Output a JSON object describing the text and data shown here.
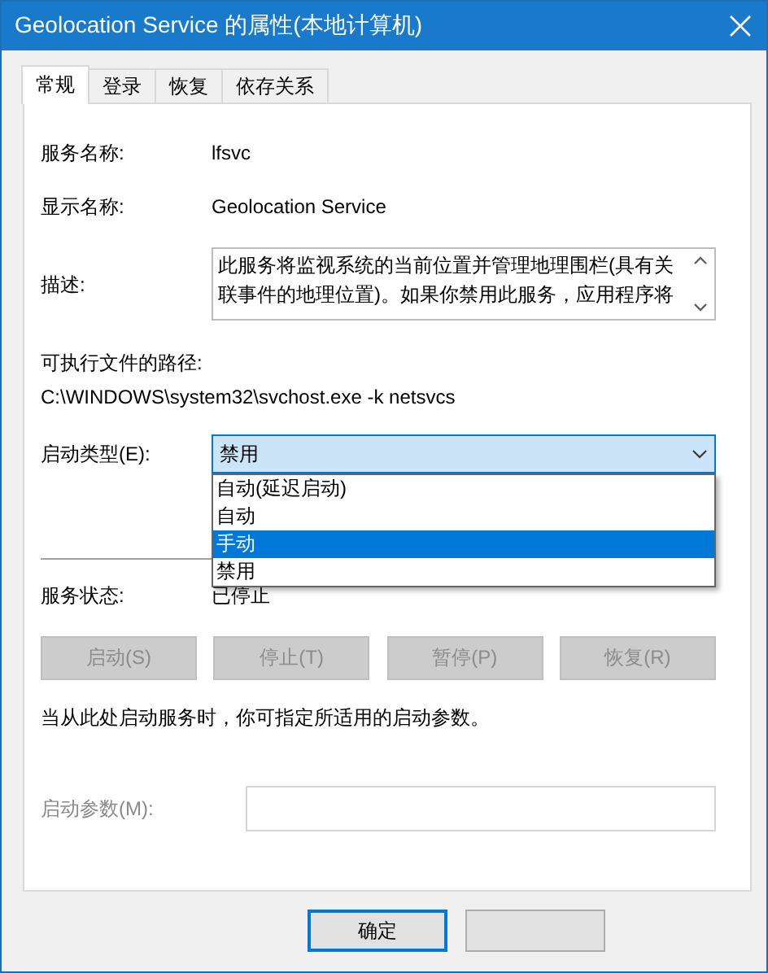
{
  "window": {
    "title": "Geolocation Service 的属性(本地计算机)"
  },
  "tabs": [
    {
      "label": "常规",
      "selected": true
    },
    {
      "label": "登录",
      "selected": false
    },
    {
      "label": "恢复",
      "selected": false
    },
    {
      "label": "依存关系",
      "selected": false
    }
  ],
  "fields": [
    {
      "label": "服务名称:",
      "value": "lfsvc"
    },
    {
      "label": "显示名称:",
      "value": "Geolocation Service"
    }
  ],
  "description": {
    "label": "描述:",
    "text": "此服务将监视系统的当前位置并管理地理围栏(具有关联事件的地理位置)。如果你禁用此服务，应用程序将"
  },
  "path": {
    "label": "可执行文件的路径:",
    "value": "C:\\WINDOWS\\system32\\svchost.exe -k netsvcs"
  },
  "startup_type": {
    "label": "启动类型(E):",
    "value": "禁用",
    "expanded": true,
    "options": [
      {
        "label": "自动(延迟启动)",
        "highlighted": false
      },
      {
        "label": "自动",
        "highlighted": false
      },
      {
        "label": "手动",
        "highlighted": true
      },
      {
        "label": "禁用",
        "highlighted": false
      }
    ]
  },
  "service_status": {
    "label": "服务状态:",
    "value": "已停止"
  },
  "service_buttons": [
    {
      "label": "启动(S)",
      "disabled": true
    },
    {
      "label": "停止(T)",
      "disabled": true
    },
    {
      "label": "暂停(P)",
      "disabled": true
    },
    {
      "label": "恢复(R)",
      "disabled": true
    }
  ],
  "hint": "当从此处启动服务时，你可指定所适用的启动参数。",
  "start_parameters": {
    "label": "启动参数(M):",
    "disabled": true
  },
  "buttons": [
    {
      "label": "确定",
      "default": true
    },
    {
      "default": false
    }
  ]
}
